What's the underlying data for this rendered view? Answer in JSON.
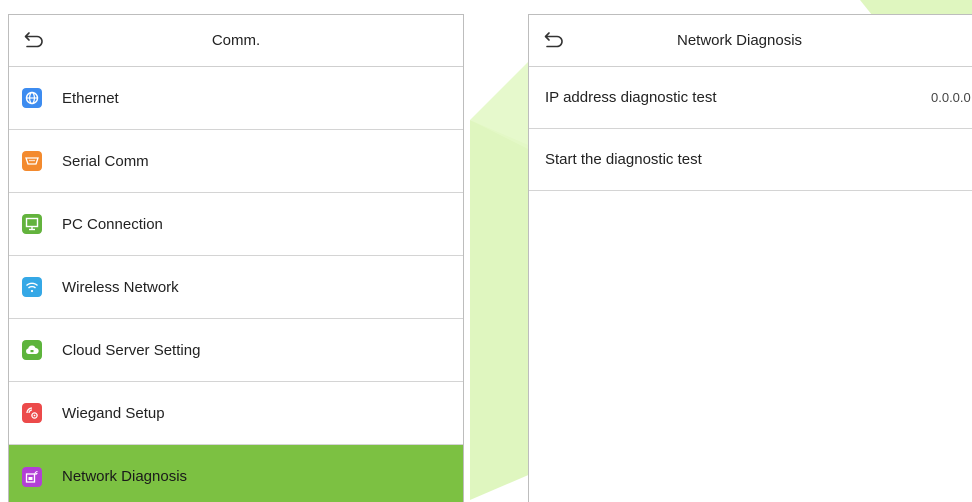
{
  "left": {
    "title": "Comm.",
    "items": [
      {
        "label": "Ethernet",
        "icon": "globe-icon",
        "color": "#3d8cf0"
      },
      {
        "label": "Serial Comm",
        "icon": "serial-port-icon",
        "color": "#f38a2e"
      },
      {
        "label": "PC Connection",
        "icon": "monitor-icon",
        "color": "#63b33d"
      },
      {
        "label": "Wireless Network",
        "icon": "wifi-icon",
        "color": "#35a8e6"
      },
      {
        "label": "Cloud Server Setting",
        "icon": "cloud-icon",
        "color": "#5db43c"
      },
      {
        "label": "Wiegand Setup",
        "icon": "wiegand-icon",
        "color": "#ec4a4a"
      },
      {
        "label": "Network Diagnosis",
        "icon": "network-diagnosis-icon",
        "color": "#b23fd6"
      }
    ],
    "active_index": 6
  },
  "right": {
    "title": "Network Diagnosis",
    "items": [
      {
        "label": "IP address diagnostic test",
        "value": "0.0.0.0"
      },
      {
        "label": "Start the diagnostic test",
        "value": ""
      }
    ]
  },
  "colors": {
    "active_row": "#7cc142",
    "border": "#bdbdbd",
    "watermark": "#d6f5b0"
  }
}
